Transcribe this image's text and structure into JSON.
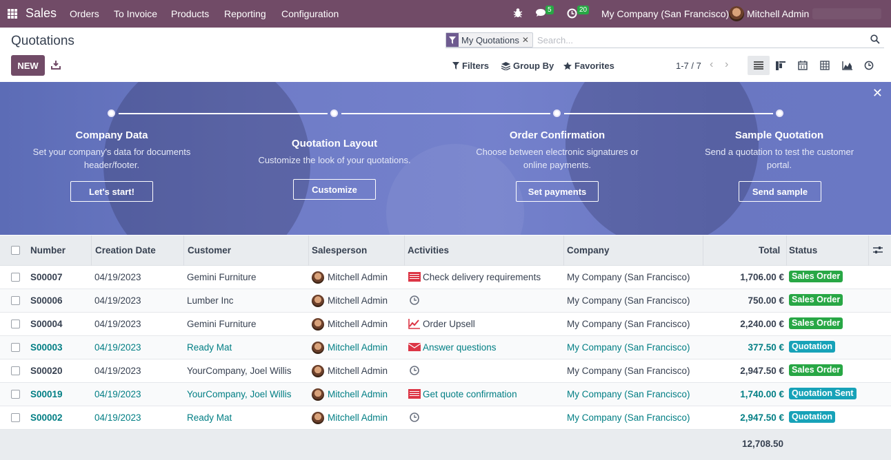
{
  "topbar": {
    "app_name": "Sales",
    "menu": [
      "Orders",
      "To Invoice",
      "Products",
      "Reporting",
      "Configuration"
    ],
    "messages_count": "5",
    "activities_count": "20",
    "company": "My Company (San Francisco)",
    "user": "Mitchell Admin",
    "bg_color": "#714B67"
  },
  "control": {
    "title": "Quotations",
    "new_label": "NEW",
    "facet_label": "My Quotations",
    "search_placeholder": "Search...",
    "filters_label": "Filters",
    "groupby_label": "Group By",
    "favorites_label": "Favorites",
    "pager": "1-7 / 7"
  },
  "banner": {
    "steps": [
      {
        "title": "Company Data",
        "desc": "Set your company's data for documents header/footer.",
        "button": "Let's start!"
      },
      {
        "title": "Quotation Layout",
        "desc": "Customize the look of your quotations.",
        "button": "Customize"
      },
      {
        "title": "Order Confirmation",
        "desc": "Choose between electronic signatures or online payments.",
        "button": "Set payments"
      },
      {
        "title": "Sample Quotation",
        "desc": "Send a quotation to test the customer portal.",
        "button": "Send sample"
      }
    ]
  },
  "table": {
    "headers": {
      "number": "Number",
      "date": "Creation Date",
      "customer": "Customer",
      "salesperson": "Salesperson",
      "activities": "Activities",
      "company": "Company",
      "total": "Total",
      "status": "Status"
    },
    "rows": [
      {
        "number": "S00007",
        "date": "04/19/2023",
        "customer": "Gemini Furniture",
        "salesperson": "Mitchell Admin",
        "activity": "Check delivery requirements",
        "company": "My Company (San Francisco)",
        "total": "1,706.00 €",
        "status": "Sales Order"
      },
      {
        "number": "S00006",
        "date": "04/19/2023",
        "customer": "Lumber Inc",
        "salesperson": "Mitchell Admin",
        "activity": "",
        "company": "My Company (San Francisco)",
        "total": "750.00 €",
        "status": "Sales Order"
      },
      {
        "number": "S00004",
        "date": "04/19/2023",
        "customer": "Gemini Furniture",
        "salesperson": "Mitchell Admin",
        "activity": "Order Upsell",
        "company": "My Company (San Francisco)",
        "total": "2,240.00 €",
        "status": "Sales Order"
      },
      {
        "number": "S00003",
        "date": "04/19/2023",
        "customer": "Ready Mat",
        "salesperson": "Mitchell Admin",
        "activity": "Answer questions",
        "company": "My Company (San Francisco)",
        "total": "377.50 €",
        "status": "Quotation"
      },
      {
        "number": "S00020",
        "date": "04/19/2023",
        "customer": "YourCompany, Joel Willis",
        "salesperson": "Mitchell Admin",
        "activity": "",
        "company": "My Company (San Francisco)",
        "total": "2,947.50 €",
        "status": "Sales Order"
      },
      {
        "number": "S00019",
        "date": "04/19/2023",
        "customer": "YourCompany, Joel Willis",
        "salesperson": "Mitchell Admin",
        "activity": "Get quote confirmation",
        "company": "My Company (San Francisco)",
        "total": "1,740.00 €",
        "status": "Quotation Sent"
      },
      {
        "number": "S00002",
        "date": "04/19/2023",
        "customer": "Ready Mat",
        "salesperson": "Mitchell Admin",
        "activity": "",
        "company": "My Company (San Francisco)",
        "total": "2,947.50 €",
        "status": "Quotation"
      }
    ],
    "grand_total": "12,708.50"
  }
}
